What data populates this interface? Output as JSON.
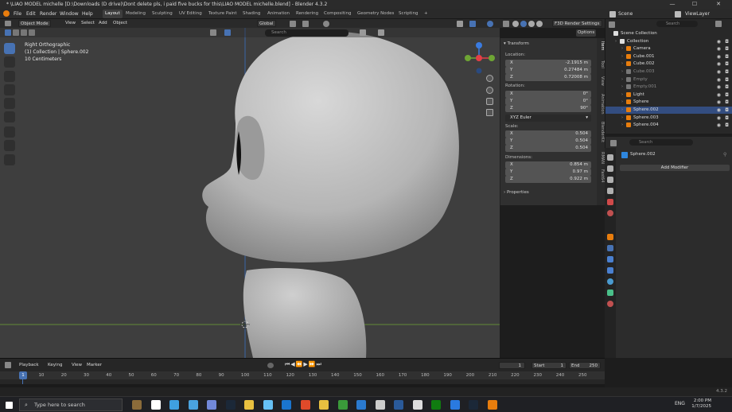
{
  "window": {
    "title": "* \\LIAO MODEL michelle [D:\\Downloads (D drive)\\Dont delete pls, i paid five bucks for this\\LIAO MODEL michelle.blend] - Blender 4.3.2",
    "minimize": "—",
    "maximize": "☐",
    "close": "✕"
  },
  "menu": [
    "File",
    "Edit",
    "Render",
    "Window",
    "Help"
  ],
  "workspaces": [
    "Layout",
    "Modeling",
    "Sculpting",
    "UV Editing",
    "Texture Paint",
    "Shading",
    "Animation",
    "Rendering",
    "Compositing",
    "Geometry Nodes",
    "Scripting",
    "+"
  ],
  "scene": {
    "label": "Scene",
    "view_layer": "ViewLayer"
  },
  "viewport_header": {
    "mode": "Object Mode",
    "items": [
      "View",
      "Select",
      "Add",
      "Object"
    ],
    "orientation": "Global",
    "search_placeholder": "Search",
    "options": "Options",
    "render_settings": "F3D Render Settings"
  },
  "overlay_text": {
    "line1": "Right Orthographic",
    "line2": "(1) Collection | Sphere.002",
    "line3": "10 Centimeters"
  },
  "transform_panel": {
    "title": "Transform",
    "location_label": "Location:",
    "location": [
      {
        "axis": "X",
        "value": "-2.1915 m"
      },
      {
        "axis": "Y",
        "value": "0.27484 m"
      },
      {
        "axis": "Z",
        "value": "0.72008 m"
      }
    ],
    "rotation_label": "Rotation:",
    "rotation": [
      {
        "axis": "X",
        "value": "0°"
      },
      {
        "axis": "Y",
        "value": "0°"
      },
      {
        "axis": "Z",
        "value": "90°"
      }
    ],
    "rotation_mode": "XYZ Euler",
    "scale_label": "Scale:",
    "scale": [
      {
        "axis": "X",
        "value": "0.504"
      },
      {
        "axis": "Y",
        "value": "0.504"
      },
      {
        "axis": "Z",
        "value": "0.504"
      }
    ],
    "dimensions_label": "Dimensions:",
    "dimensions": [
      {
        "axis": "X",
        "value": "0.854 m"
      },
      {
        "axis": "Y",
        "value": "0.97 m"
      },
      {
        "axis": "Z",
        "value": "0.922 m"
      }
    ],
    "properties": "Properties"
  },
  "side_tabs": [
    "Item",
    "Tool",
    "View",
    "Animation",
    "BlenderKit",
    "RMAN",
    "Fast64"
  ],
  "outliner": {
    "search_placeholder": "Search",
    "rows": [
      {
        "name": "Scene Collection",
        "indent": 0,
        "state": "normal"
      },
      {
        "name": "Collection",
        "indent": 1,
        "state": "normal"
      },
      {
        "name": "Camera",
        "indent": 2,
        "state": "normal"
      },
      {
        "name": "Cube.001",
        "indent": 2,
        "state": "normal"
      },
      {
        "name": "Cube.002",
        "indent": 2,
        "state": "normal"
      },
      {
        "name": "Cube.003",
        "indent": 2,
        "state": "dim"
      },
      {
        "name": "Empty",
        "indent": 2,
        "state": "dim"
      },
      {
        "name": "Empty.001",
        "indent": 2,
        "state": "dim"
      },
      {
        "name": "Light",
        "indent": 2,
        "state": "normal"
      },
      {
        "name": "Sphere",
        "indent": 2,
        "state": "normal"
      },
      {
        "name": "Sphere.002",
        "indent": 2,
        "state": "sel"
      },
      {
        "name": "Sphere.003",
        "indent": 2,
        "state": "normal"
      },
      {
        "name": "Sphere.004",
        "indent": 2,
        "state": "normal"
      }
    ]
  },
  "properties": {
    "search_placeholder": "Search",
    "object_name": "Sphere.002",
    "add_modifier": "Add Modifier"
  },
  "timeline": {
    "items": [
      "Playback",
      "Keying",
      "View",
      "Marker"
    ],
    "current_frame": "1",
    "start_label": "Start",
    "start": "1",
    "end_label": "End",
    "end": "250",
    "ticks": [
      "10",
      "20",
      "30",
      "40",
      "50",
      "60",
      "70",
      "80",
      "90",
      "100",
      "110",
      "120",
      "130",
      "140",
      "150",
      "160",
      "170",
      "180",
      "190",
      "200",
      "210",
      "220",
      "230",
      "240",
      "250"
    ],
    "playhead_frame": "1"
  },
  "status": {
    "version": "4.3.2"
  },
  "taskbar": {
    "search_placeholder": "Type here to search",
    "lang": "ENG",
    "time": "2:00 PM",
    "date": "1/7/2025",
    "app_colors": [
      "#8b6b3a",
      "#ffffff",
      "#3fa0e0",
      "#4aa3df",
      "#7289da",
      "#1b2838",
      "#e8c040",
      "#66c0f4",
      "#1a75cf",
      "#e04a2a",
      "#e8c040",
      "#3a9a3a",
      "#2a7ad0",
      "#cccccc",
      "#2a5a9a",
      "#dddddd",
      "#107c10",
      "#2a7ae0",
      "#1b2838",
      "#e87d0d"
    ]
  },
  "colors": {
    "accent": "#4772b3",
    "selection": "#334d80",
    "x_axis": "#e43f46",
    "y_axis": "#6ea534",
    "z_axis": "#3a7be0",
    "viewport_bg": "#3e3e3e"
  }
}
